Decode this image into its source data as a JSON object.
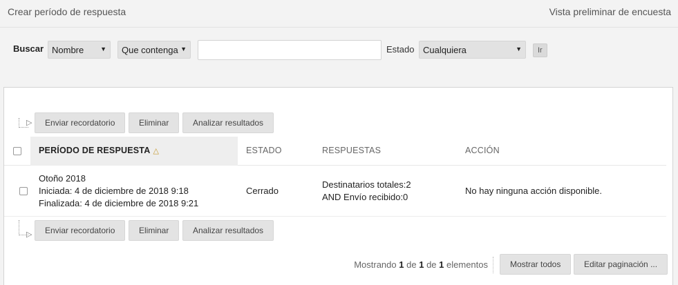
{
  "topbar": {
    "create_label": "Crear período de respuesta",
    "preview_label": "Vista preliminar de encuesta"
  },
  "search": {
    "label": "Buscar",
    "field_select": "Nombre",
    "operator_select": "Que contenga",
    "query_value": "",
    "state_label": "Estado",
    "state_select": "Cualquiera",
    "go_label": "Ir"
  },
  "actions_top": {
    "remind": "Enviar recordatorio",
    "delete": "Eliminar",
    "analyze": "Analizar resultados"
  },
  "actions_bottom": {
    "remind": "Enviar recordatorio",
    "delete": "Eliminar",
    "analyze": "Analizar resultados"
  },
  "table": {
    "headers": {
      "period": "PERÍODO DE RESPUESTA",
      "state": "ESTADO",
      "responses": "RESPUESTAS",
      "action": "ACCIÓN"
    },
    "rows": [
      {
        "name": "Otoño 2018",
        "started": "Iniciada: 4 de diciembre de 2018 9:18",
        "ended": "Finalizada: 4 de diciembre de 2018 9:21",
        "state": "Cerrado",
        "recipients": "Destinatarios totales:2",
        "received": "AND Envío recibido:0",
        "action": "No hay ninguna acción disponible."
      }
    ]
  },
  "pagination": {
    "showing_prefix": "Mostrando",
    "from": "1",
    "de1": "de",
    "to": "1",
    "de2": "de",
    "total": "1",
    "suffix": "elementos",
    "show_all": "Mostrar todos",
    "edit_paging": "Editar paginación ..."
  },
  "colors": {
    "background": "#f3f3f3",
    "panel": "#ffffff",
    "button": "#e3e3e3",
    "sort_icon": "#c69a2f"
  }
}
